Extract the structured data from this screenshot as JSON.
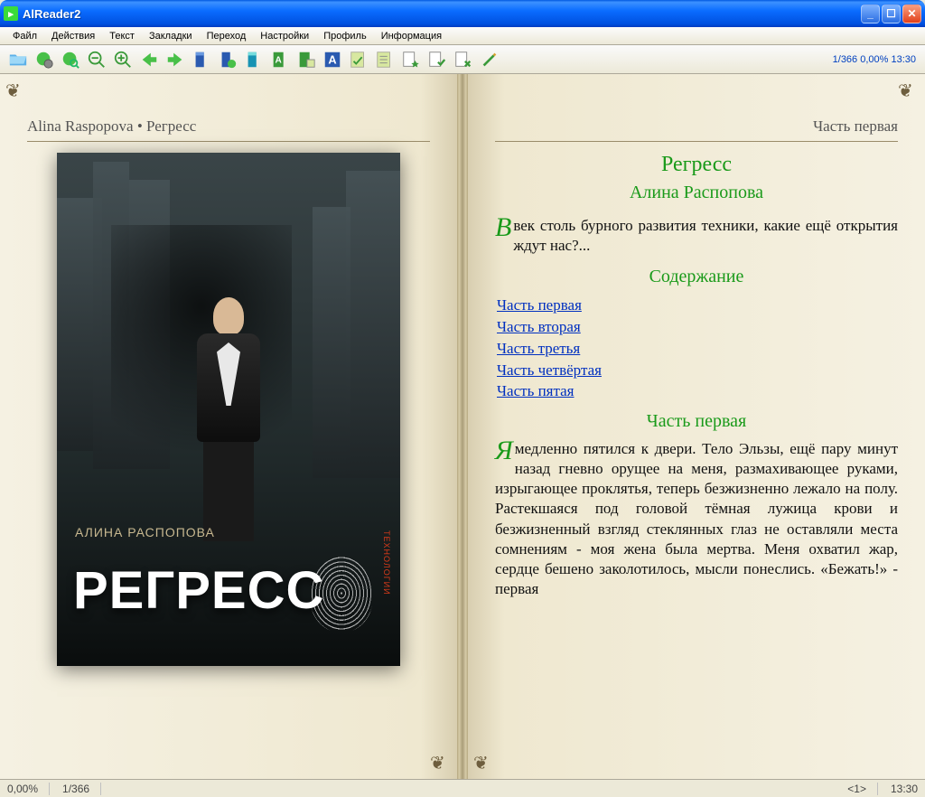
{
  "app": {
    "title": "AlReader2"
  },
  "menu": [
    "Файл",
    "Действия",
    "Текст",
    "Закладки",
    "Переход",
    "Настройки",
    "Профиль",
    "Информация"
  ],
  "toolbar_icons": [
    "open-folder",
    "globe-gear",
    "globe-search",
    "zoom-out",
    "zoom-in",
    "arrow-left",
    "arrow-right",
    "bookmark-blue",
    "bookmark-green",
    "bookmark-cyan",
    "bookmark-a",
    "bookmark-toggle",
    "font-a",
    "note-check",
    "note",
    "doc-star",
    "doc-check",
    "doc-x",
    "pencil"
  ],
  "toolbar_status": "1/366 0,00% 13:30",
  "left_page": {
    "header": "Alina Raspopova • Регресс",
    "cover": {
      "author": "АЛИНА РАСПОПОВА",
      "title": "РЕГРЕСС",
      "side_text": "ТЕХНОЛОГИИ"
    }
  },
  "right_page": {
    "header": "Часть первая",
    "title": "Регресс",
    "author": "Алина Распопова",
    "intro_dropcap": "В",
    "intro_rest": " век столь бурного развития техники, какие ещё открытия ждут нас?...",
    "toc_heading": "Содержание",
    "toc": [
      "Часть первая",
      "Часть вторая",
      "Часть третья",
      "Часть четвёртая",
      "Часть пятая"
    ],
    "section_heading": "Часть первая",
    "p1_dropcap": "Я",
    "p1_rest": " медленно пятился к двери. Тело Эльзы, ещё пару минут назад гневно орущее на меня, размахивающее руками, изрыгающее проклятья, теперь безжизненно лежало на полу. Растекшаяся под головой тёмная лужица крови и безжизненный взгляд стеклянных глаз не оставляли места сомнениям - моя жена была мертва. Меня охватил жар, сердце бешено заколотилось, мысли понеслись. «Бежать!» - первая"
  },
  "status": {
    "percent": "0,00%",
    "page": "1/366",
    "marker": "<1>",
    "time": "13:30"
  }
}
